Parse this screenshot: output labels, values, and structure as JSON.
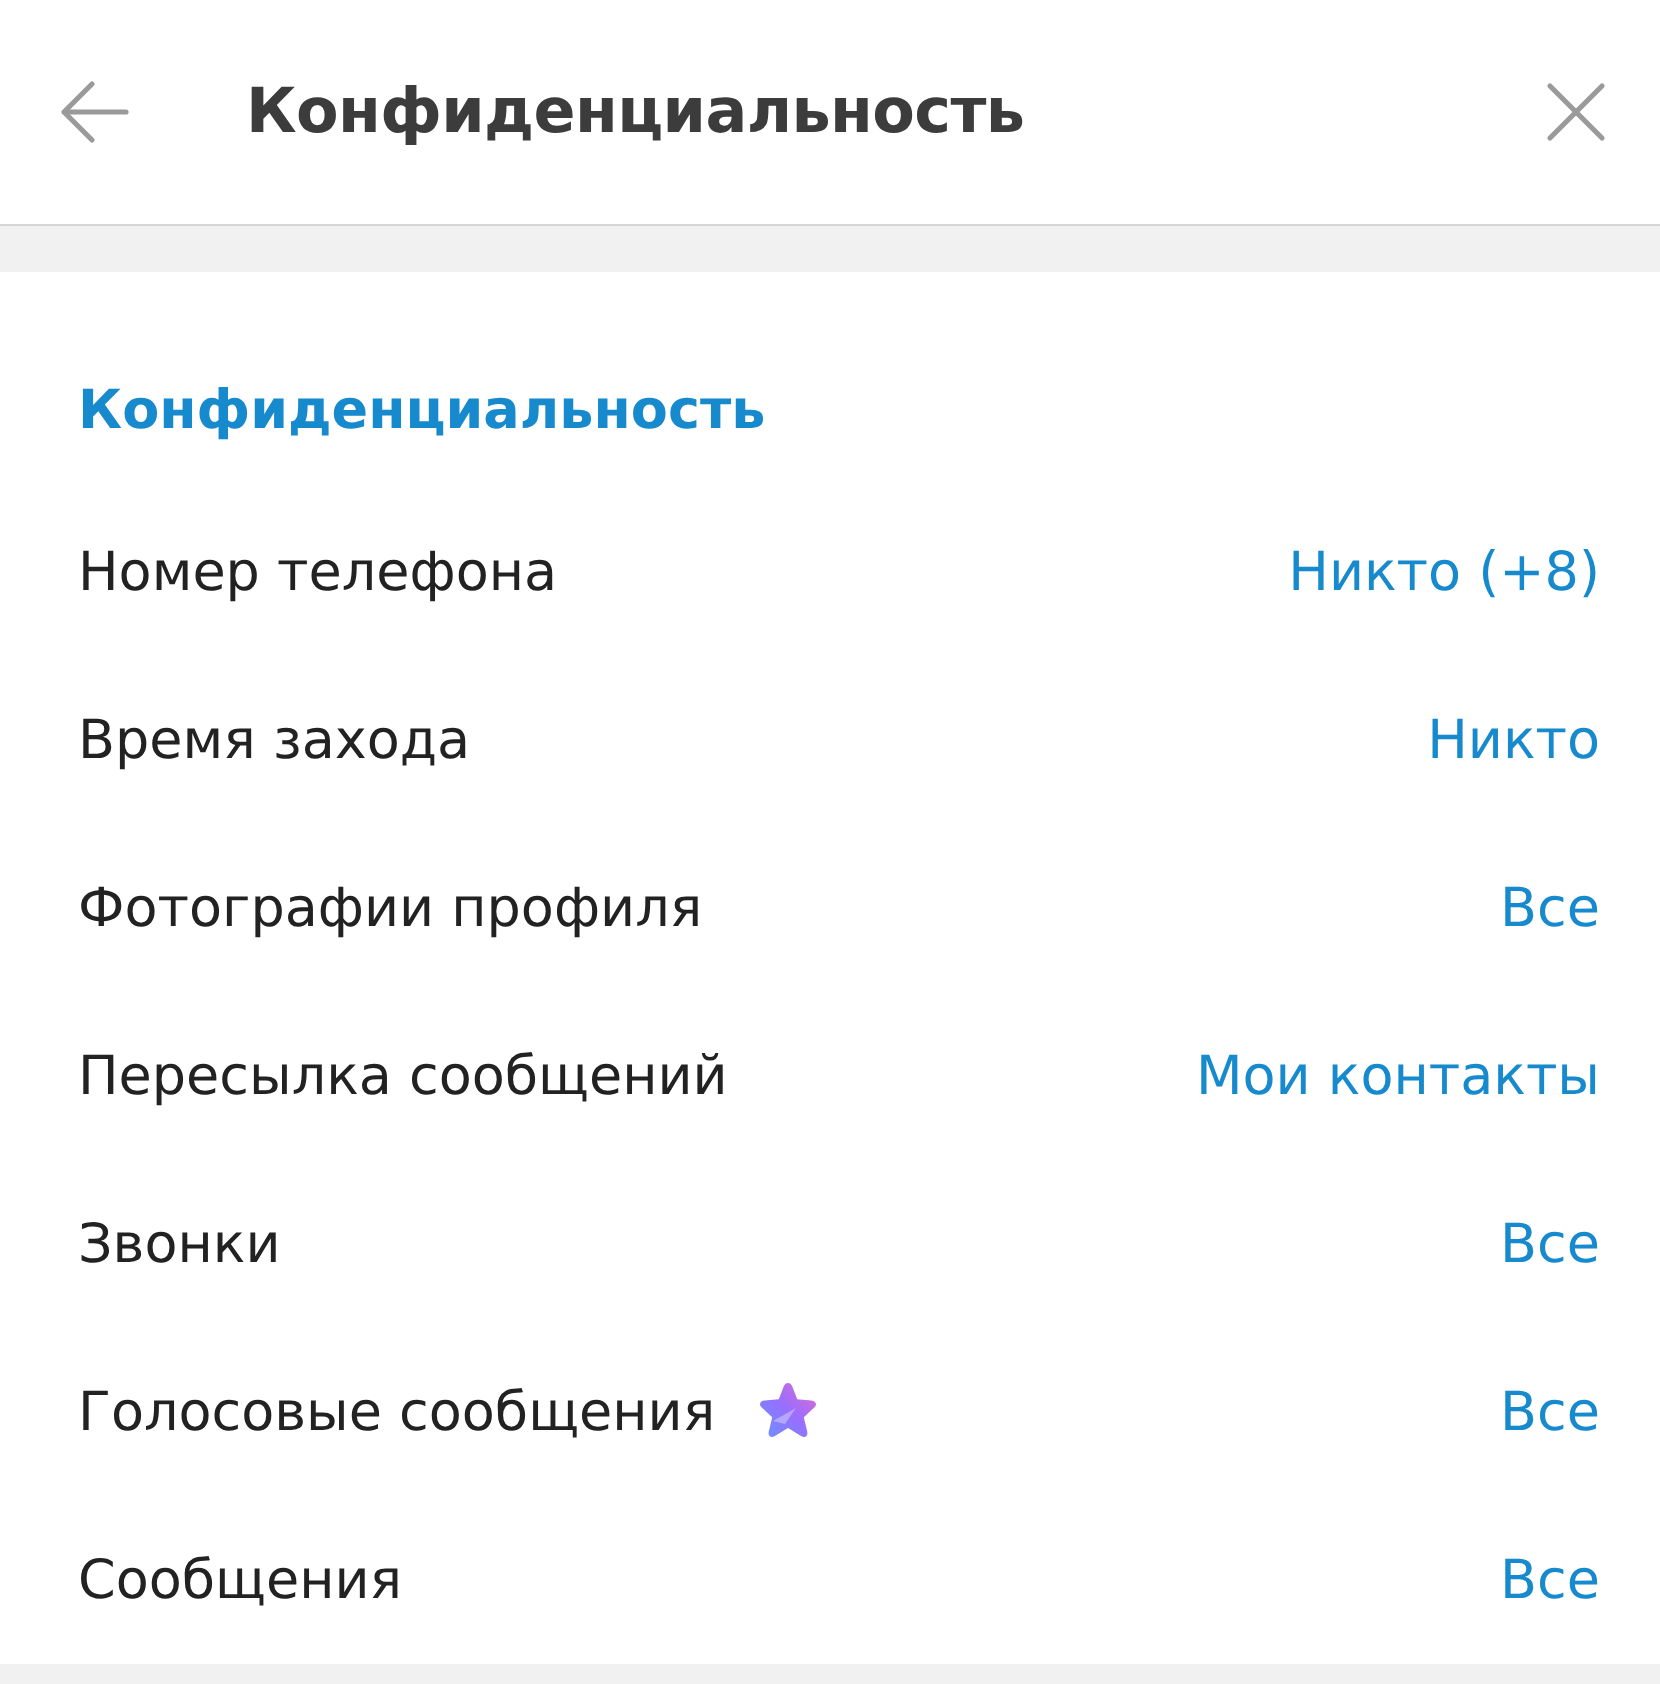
{
  "header": {
    "title": "Конфиденциальность"
  },
  "section": {
    "title": "Конфиденциальность",
    "rows": [
      {
        "label": "Номер телефона",
        "value": "Никто (+8)",
        "premium": false
      },
      {
        "label": "Время захода",
        "value": "Никто",
        "premium": false
      },
      {
        "label": "Фотографии профиля",
        "value": "Все",
        "premium": false
      },
      {
        "label": "Пересылка сообщений",
        "value": "Мои контакты",
        "premium": false
      },
      {
        "label": "Звонки",
        "value": "Все",
        "premium": false
      },
      {
        "label": "Голосовые сообщения",
        "value": "Все",
        "premium": true
      },
      {
        "label": "Сообщения",
        "value": "Все",
        "premium": false
      }
    ]
  }
}
